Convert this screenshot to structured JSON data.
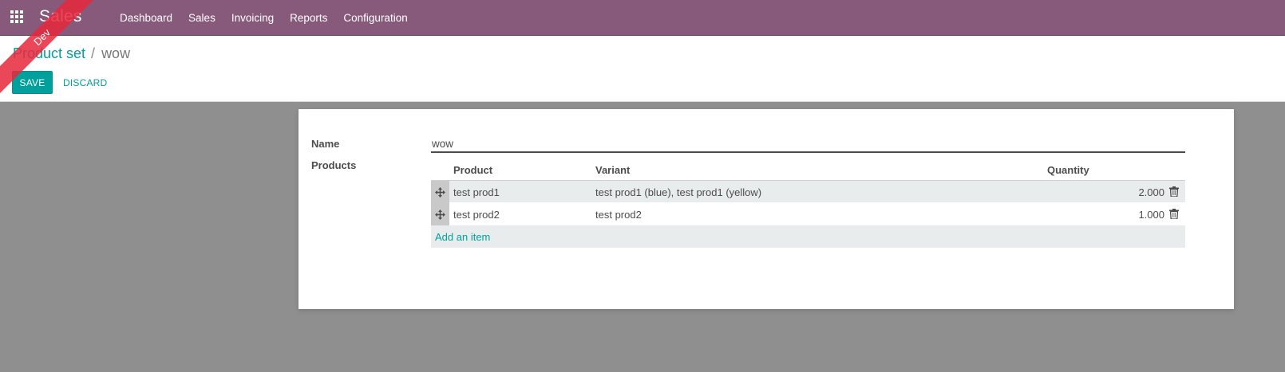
{
  "navbar": {
    "brand": "Sales",
    "menu": [
      "Dashboard",
      "Sales",
      "Invoicing",
      "Reports",
      "Configuration"
    ],
    "color": "#875a7b"
  },
  "ribbon": {
    "label": "Dev"
  },
  "breadcrumb": {
    "parent": "Product set",
    "separator": "/",
    "current": "wow"
  },
  "buttons": {
    "save": "SAVE",
    "discard": "DISCARD"
  },
  "form": {
    "name_label": "Name",
    "name_value": "wow",
    "products_label": "Products",
    "columns": {
      "product": "Product",
      "variant": "Variant",
      "quantity": "Quantity"
    },
    "rows": [
      {
        "product": "test prod1",
        "variant": "test prod1 (blue), test prod1 (yellow)",
        "quantity": "2.000"
      },
      {
        "product": "test prod2",
        "variant": "test prod2",
        "quantity": "1.000"
      }
    ],
    "add_item": "Add an item"
  },
  "icons": {
    "apps": "apps-grid-icon",
    "drag": "drag-handle-icon",
    "delete": "trash-icon"
  }
}
